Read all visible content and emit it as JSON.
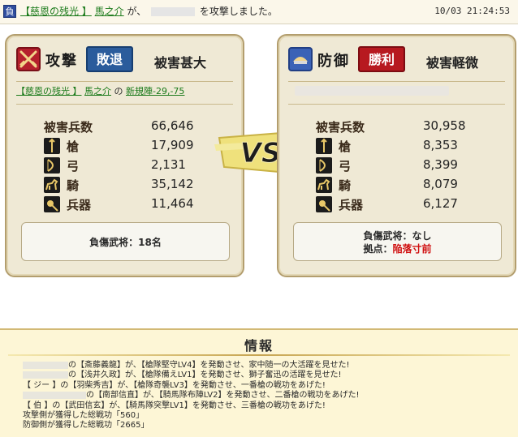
{
  "topbar": {
    "badge": "負",
    "msg_guild": "【慈恩の残光 】",
    "msg_player": "馬之介",
    "msg_text": "が、",
    "msg_suffix": "を攻撃しました。",
    "time": "10/03 21:24:53"
  },
  "attacker": {
    "role": "攻撃",
    "result": "敗退",
    "damage_level": "被害甚大",
    "guild": "【慈恩の残光 】",
    "player": "馬之介",
    "player_sep": " の ",
    "location": "新規陣-29,-75",
    "loss_label": "被害兵数",
    "loss_total": "66,646",
    "units": [
      {
        "label": "槍",
        "value": "17,909",
        "icon": "spear-icon"
      },
      {
        "label": "弓",
        "value": "2,131",
        "icon": "bow-icon"
      },
      {
        "label": "騎",
        "value": "35,142",
        "icon": "horse-icon"
      },
      {
        "label": "兵器",
        "value": "11,464",
        "icon": "siege-icon"
      }
    ],
    "injured": "負傷武将：18名"
  },
  "defender": {
    "role": "防御",
    "result": "勝利",
    "damage_level": "被害軽微",
    "loss_label": "被害兵数",
    "loss_total": "30,958",
    "units": [
      {
        "label": "槍",
        "value": "8,353",
        "icon": "spear-icon"
      },
      {
        "label": "弓",
        "value": "8,399",
        "icon": "bow-icon"
      },
      {
        "label": "騎",
        "value": "8,079",
        "icon": "horse-icon"
      },
      {
        "label": "兵器",
        "value": "6,127",
        "icon": "siege-icon"
      }
    ],
    "injured": "負傷武将：なし",
    "base_label": "拠点：",
    "base_status": "陥落寸前"
  },
  "vs": "VS",
  "info": {
    "title": "情報",
    "lines": [
      "の【斎藤義龍】が、【槍隊堅守LV4】を発動させ、家中随一の大活躍を見せた!",
      "の【浅井久政】が、【槍隊備えLV1】を発動させ、獅子奮迅の活躍を見せた!",
      "【 ジー 】の【羽柴秀吉】が、【槍隊奇襲LV3】を発動させ、一番槍の戦功をあげた!",
      "の【南部信直】が、【騎馬隊布陣LV2】を発動させ、二番槍の戦功をあげた!",
      "【 伯 】の【武田信玄】が、【騎馬隊突撃LV1】を発動させ、三番槍の戦功をあげた!",
      "攻撃側が獲得した総戦功「560」",
      "防御側が獲得した総戦功「2665」"
    ]
  },
  "colors": {
    "accent_gold": "#c7a552",
    "lose_blue": "#2b5c9c",
    "win_red": "#b71920",
    "link_green": "#1a7a1a",
    "danger_red": "#d01010"
  }
}
